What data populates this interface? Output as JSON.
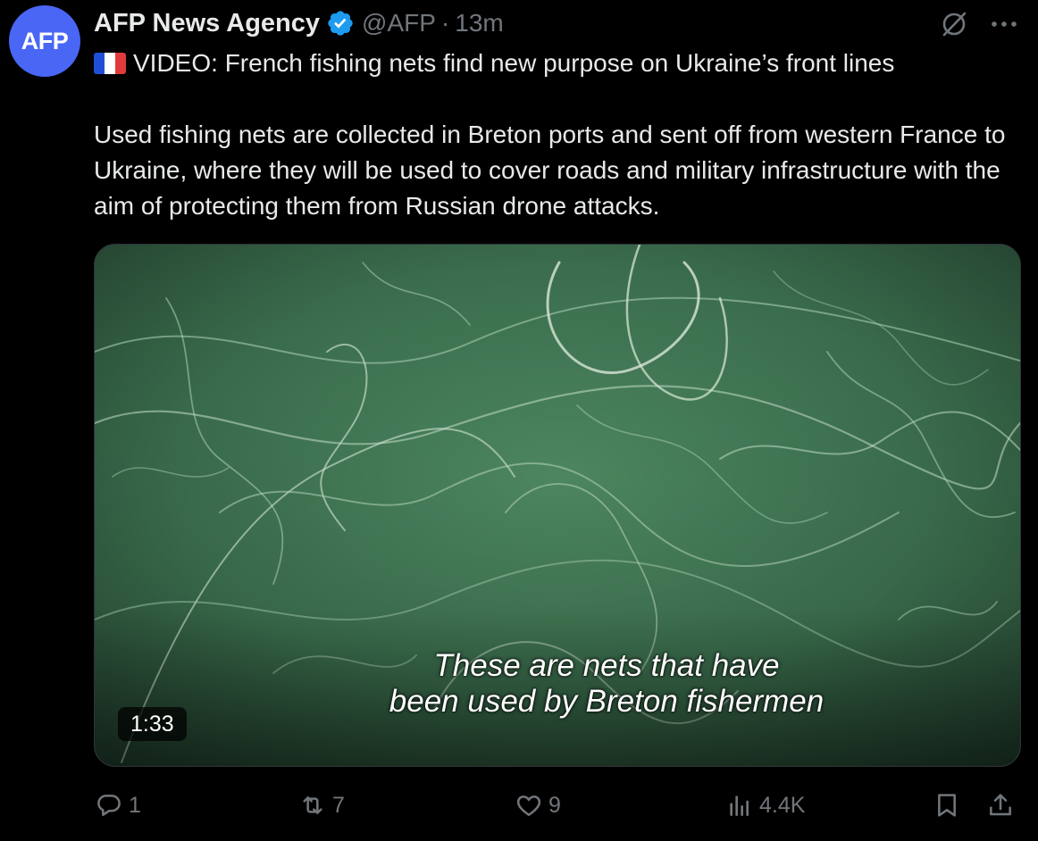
{
  "author": {
    "avatar_text": "AFP",
    "name": "AFP News Agency",
    "handle": "@AFP",
    "separator": "·",
    "time": "13m",
    "verified": true
  },
  "tweet": {
    "flag_icon": "france-flag-icon",
    "headline": "VIDEO: French fishing nets find new purpose on Ukraine’s front lines",
    "body": "Used fishing nets are collected in Breton ports and sent off from western France to Ukraine, where they will be used to cover roads and military infrastructure with the aim of protecting them from Russian drone attacks."
  },
  "media": {
    "type": "video",
    "subtitle_line1": "These are nets that have",
    "subtitle_line2": "been used by Breton fishermen",
    "duration": "1:33"
  },
  "actions": {
    "replies": "1",
    "reposts": "7",
    "likes": "9",
    "views": "4.4K"
  },
  "colors": {
    "background": "#000000",
    "text_primary": "#e7e9ea",
    "text_secondary": "#71767b",
    "avatar": "#4a66f5",
    "verified_badge": "#1d9bf0"
  }
}
